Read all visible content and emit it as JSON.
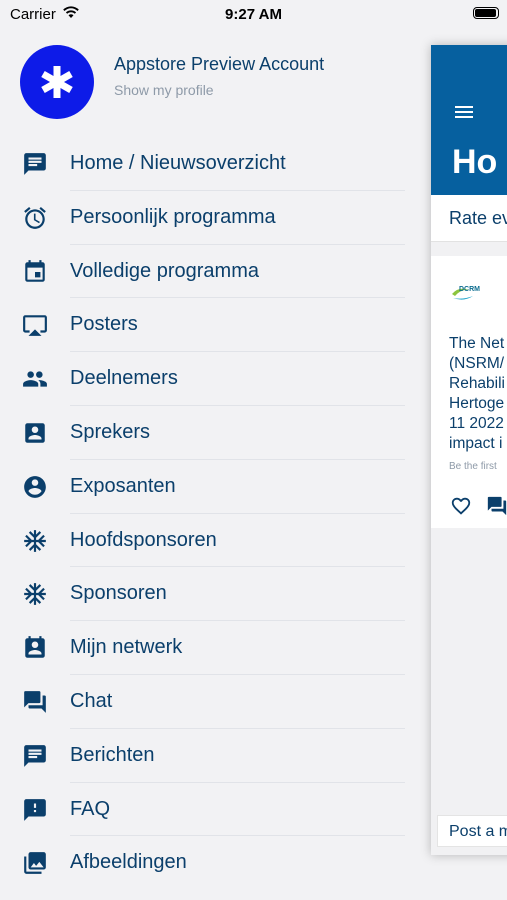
{
  "status_bar": {
    "carrier": "Carrier",
    "time": "9:27 AM"
  },
  "profile": {
    "name": "Appstore Preview Account",
    "link": "Show my profile",
    "avatar_icon": "asterisk-icon",
    "avatar_color": "#0d1be8"
  },
  "menu": [
    {
      "label": "Home / Nieuwsoverzicht",
      "icon": "message-icon"
    },
    {
      "label": "Persoonlijk programma",
      "icon": "alarm-icon"
    },
    {
      "label": "Volledige programma",
      "icon": "calendar-icon"
    },
    {
      "label": "Posters",
      "icon": "airplay-icon"
    },
    {
      "label": "Deelnemers",
      "icon": "people-icon"
    },
    {
      "label": "Sprekers",
      "icon": "contact-card-icon"
    },
    {
      "label": "Exposanten",
      "icon": "account-circle-icon"
    },
    {
      "label": "Hoofdsponsoren",
      "icon": "snowflake-icon"
    },
    {
      "label": "Sponsoren",
      "icon": "snowflake-icon"
    },
    {
      "label": "Mijn netwerk",
      "icon": "contact-badge-icon"
    },
    {
      "label": "Chat",
      "icon": "forum-icon"
    },
    {
      "label": "Berichten",
      "icon": "message-icon"
    },
    {
      "label": "FAQ",
      "icon": "alert-box-icon"
    },
    {
      "label": "Afbeeldingen",
      "icon": "photo-library-icon"
    }
  ],
  "preview": {
    "title": "Ho",
    "rate_text": "Rate ev",
    "logo_text": "DCRM",
    "post_text": "The Net\n(NSRM/\nRehabili\nHertoge\n11 2022\nimpact i",
    "first_text": "Be the first",
    "post_input": "Post a m",
    "header_color": "#06609f"
  },
  "colors": {
    "text": "#0b3f6b",
    "muted": "#8e9aa8",
    "background": "#f2f2f4"
  }
}
